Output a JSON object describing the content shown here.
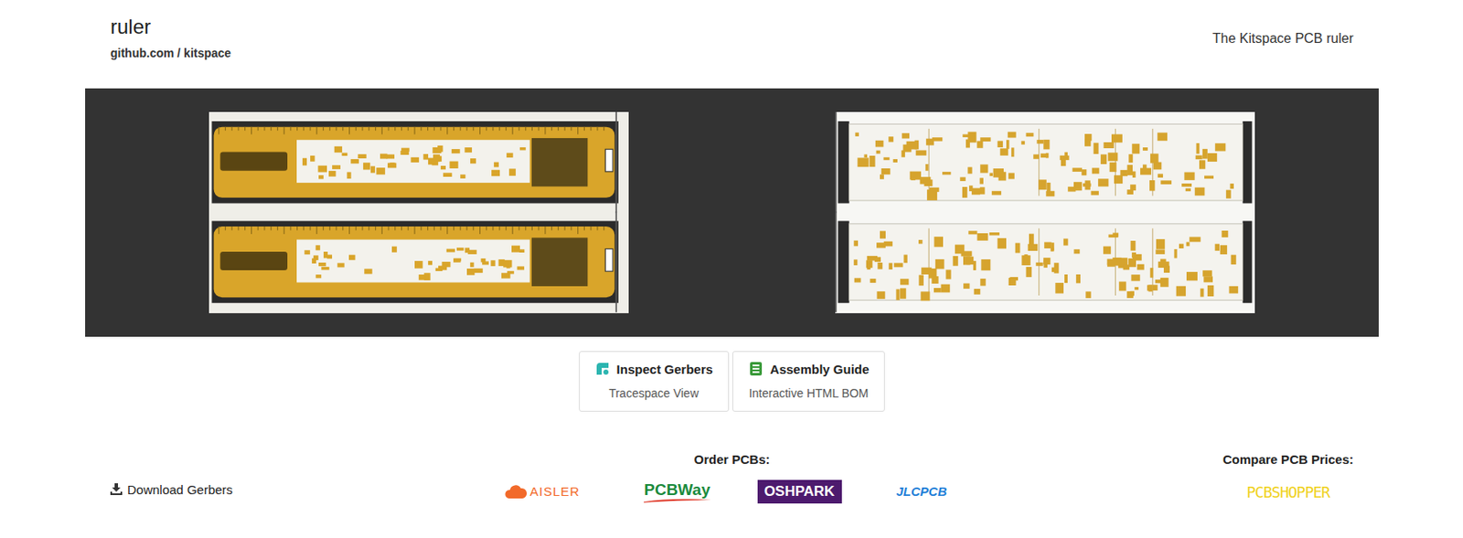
{
  "project": {
    "title": "ruler",
    "source": "github.com / kitspace",
    "summary": "The Kitspace PCB ruler"
  },
  "views": [
    {
      "label": "Inspect Gerbers",
      "sublabel": "Tracespace View",
      "kind": "gerbers"
    },
    {
      "label": "Assembly Guide",
      "sublabel": "Interactive HTML BOM",
      "kind": "bom"
    }
  ],
  "download": {
    "label": "Download Gerbers"
  },
  "order": {
    "heading": "Order PCBs:",
    "vendors": [
      {
        "label": "AISLER",
        "kind": "cloud",
        "color": "#f26a2a"
      },
      {
        "label": "PCBWay",
        "kind": "swoosh",
        "color": "#1b8a3c"
      },
      {
        "label": "OSHPARK",
        "kind": "boxed",
        "color": "#4d1a6e"
      },
      {
        "label": "JLCPCB",
        "kind": "plain",
        "color": "#1f7fd8"
      }
    ]
  },
  "compare": {
    "heading": "Compare PCB Prices:",
    "vendor": {
      "label": "PCBSHOPPER",
      "color": "#f0d21c"
    }
  }
}
